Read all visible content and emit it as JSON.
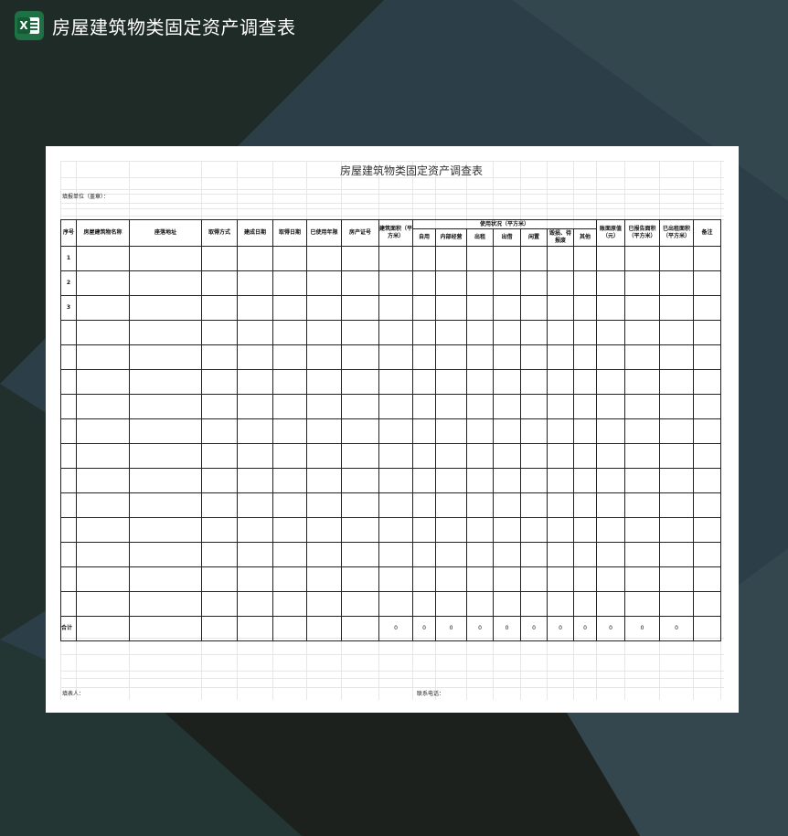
{
  "app": {
    "title": "房屋建筑物类固定资产调查表",
    "icon_letter": "X"
  },
  "doc": {
    "title": "房屋建筑物类固定资产调查表",
    "unit_label": "填报单位（盖章）：",
    "headers": {
      "seq": "序号",
      "name": "房屋建筑物名称",
      "address": "座落地址",
      "acquire_method": "取得方式",
      "build_date": "建成日期",
      "acquire_date": "取得日期",
      "years_used": "已使用年限",
      "certificate": "房产证号",
      "area": "建筑面积（平方米）",
      "usage_group": "使用状况（平方米）",
      "usage_self": "自用",
      "usage_internal": "内部经营",
      "usage_rent_out": "出租",
      "usage_lend": "出借",
      "usage_idle": "闲置",
      "usage_damaged": "毁损、待报废",
      "usage_other": "其他",
      "value": "账面原值（元）",
      "rented_area": "已报告面积（平方米）",
      "leased_area": "已出租面积（平方米）",
      "remark": "备注"
    },
    "row_numbers": [
      "1",
      "2",
      "3"
    ],
    "total_label": "合计",
    "totals": [
      "0",
      "0",
      "0",
      "0",
      "0",
      "0",
      "0",
      "0",
      "0",
      "0",
      "0"
    ],
    "footer_filler": "填表人：",
    "footer_phone": "联系电话："
  }
}
